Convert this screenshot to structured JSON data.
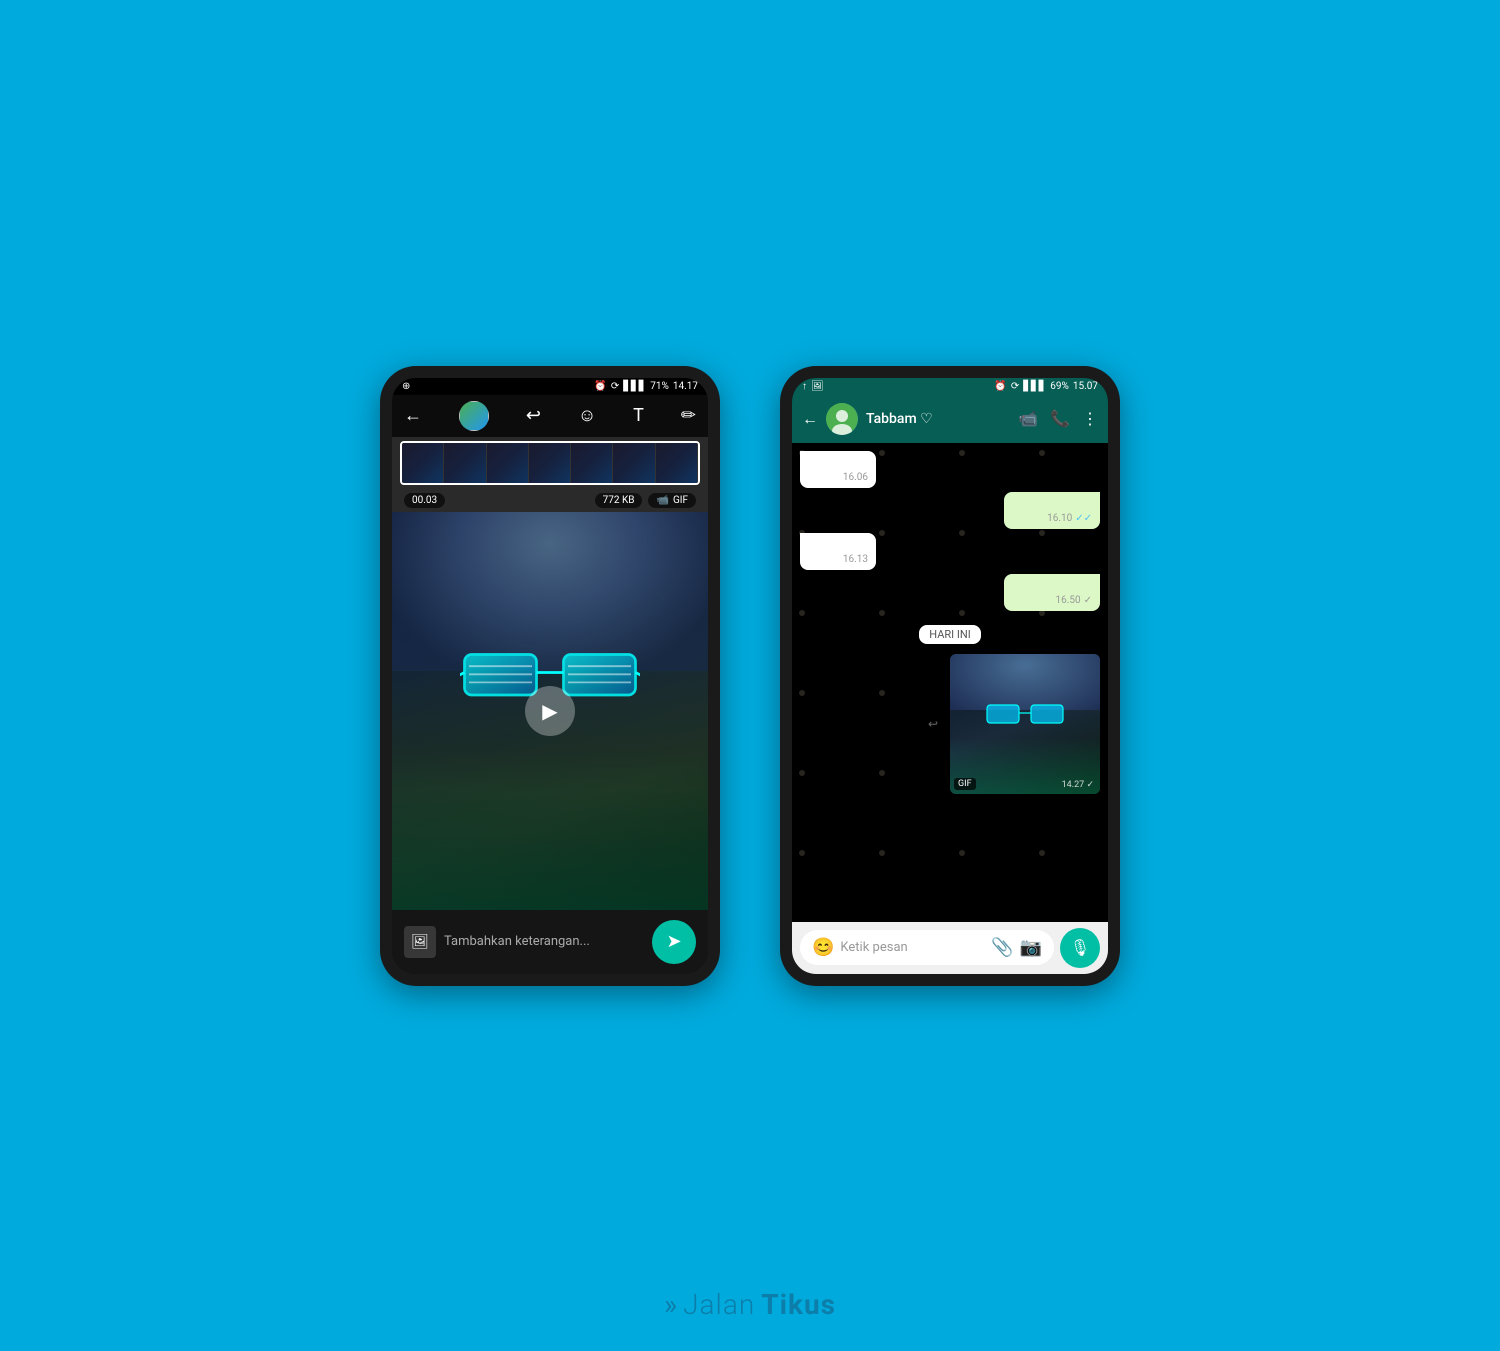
{
  "background_color": "#00AADD",
  "watermark": {
    "text_jalan": "Jalan",
    "text_tikus": "Tikus",
    "icon": "»"
  },
  "left_phone": {
    "status_bar": {
      "left_icon": "⊕",
      "time": "14.17",
      "battery": "71%",
      "icons": "🔔 ⟳ 📶 ᐧᐧᐧ"
    },
    "toolbar": {
      "back": "←",
      "undo": "↩",
      "emoji": "☺",
      "text": "T",
      "draw": "✏"
    },
    "video_meta": {
      "duration": "00.03",
      "size": "772 KB",
      "video_icon": "📹",
      "gif_label": "GIF"
    },
    "caption_placeholder": "Tambahkan keterangan...",
    "send_icon": "➤"
  },
  "right_phone": {
    "status_bar": {
      "time": "15.07",
      "battery": "69%",
      "icons": "⏰ ⟳ 📶 ᐧᐧᐧ"
    },
    "header": {
      "back": "←",
      "contact_name": "Tabbam ♡",
      "video_call_icon": "📹",
      "call_icon": "📞",
      "more_icon": "⋮"
    },
    "messages": [
      {
        "type": "received",
        "time": "16.06",
        "text": ""
      },
      {
        "type": "sent",
        "time": "16.10",
        "text": "",
        "ticks": "✓✓",
        "tick_color": "blue"
      },
      {
        "type": "received",
        "time": "16.13",
        "text": ""
      },
      {
        "type": "sent",
        "time": "16.50",
        "text": "",
        "ticks": "✓",
        "tick_color": "gray"
      }
    ],
    "date_divider": "HARI INI",
    "gif_message": {
      "gif_label": "GIF",
      "time": "14.27",
      "ticks": "✓",
      "tick_color": "gray"
    },
    "input_bar": {
      "emoji_icon": "😊",
      "placeholder": "Ketik pesan",
      "attach_icon": "📎",
      "camera_icon": "📷",
      "mic_icon": "🎙"
    }
  }
}
